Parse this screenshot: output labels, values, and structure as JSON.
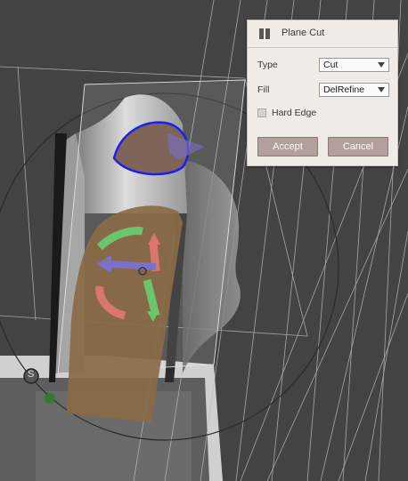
{
  "panel": {
    "title": "Plane Cut",
    "type_label": "Type",
    "type_value": "Cut",
    "fill_label": "Fill",
    "fill_value": "DelRefine",
    "hard_edge_label": "Hard Edge",
    "hard_edge_checked": false,
    "accept_label": "Accept",
    "cancel_label": "Cancel"
  },
  "viewport": {
    "gizmo_letter": "S",
    "colors": {
      "background": "#434343",
      "cut_fill": "#8a6a44",
      "cut_outline": "#1e1ef0",
      "rotate_green": "#6cc46c",
      "rotate_red": "#d9776e",
      "arrow_purple": "#7a72c8"
    }
  }
}
